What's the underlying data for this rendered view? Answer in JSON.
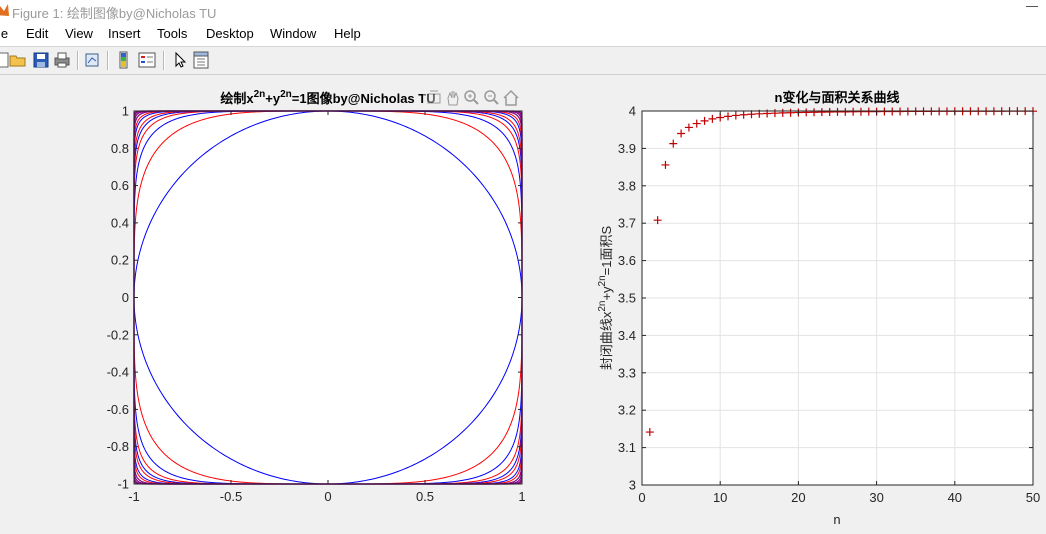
{
  "window": {
    "title": "Figure 1: 绘制图像by@Nicholas TU",
    "partial_menu_label": "le"
  },
  "menu": [
    "Edit",
    "View",
    "Insert",
    "Tools",
    "Desktop",
    "Window",
    "Help"
  ],
  "toolbar_icons": [
    "open-folder-icon",
    "save-icon",
    "print-icon",
    "link-plot-icon",
    "colorbar-icon",
    "legend-icon",
    "pointer-icon",
    "property-editor-icon"
  ],
  "axes_toolbar_icons": [
    "brush-icon",
    "pan-icon",
    "zoom-in-icon",
    "zoom-out-icon",
    "home-icon"
  ],
  "colors": {
    "blue": "#0000ff",
    "red": "#ff0000",
    "purple": "#800080",
    "marker": "#c00000"
  },
  "chart_data": [
    {
      "type": "line",
      "title_parts": {
        "prefix": "绘制x",
        "exp1": "2n",
        "mid": "+y",
        "exp2": "2n",
        "suffix": "=1图像by@Nicholas TU"
      },
      "xlabel": "",
      "ylabel": "",
      "xlim": [
        -1,
        1
      ],
      "ylim": [
        -1,
        1
      ],
      "xticks": [
        -1,
        -0.5,
        0,
        0.5,
        1
      ],
      "xtick_labels": [
        "-1",
        "-0.5",
        "0",
        "0.5",
        "1"
      ],
      "yticks": [
        -1,
        -0.8,
        -0.6,
        -0.4,
        -0.2,
        0,
        0.2,
        0.4,
        0.6,
        0.8,
        1
      ],
      "ytick_labels": [
        "-1",
        "-0.8",
        "-0.6",
        "-0.4",
        "-0.2",
        "0",
        "0.2",
        "0.4",
        "0.6",
        "0.8",
        "1"
      ],
      "grid": false,
      "curves": "superellipse x^(2n)+y^(2n)=1 for n=1..50",
      "n_values": [
        1,
        2,
        3,
        4,
        5,
        6,
        8,
        10,
        14,
        20,
        30,
        50
      ]
    },
    {
      "type": "scatter",
      "title": "n变化与面积关系曲线",
      "xlabel": "n",
      "ylabel_parts": {
        "prefix": "封闭曲线x",
        "exp1": "2n",
        "mid": "+y",
        "exp2": "2n",
        "suffix": "=1面积S"
      },
      "xlim": [
        0,
        50
      ],
      "ylim": [
        3,
        4
      ],
      "xticks": [
        0,
        10,
        20,
        30,
        40,
        50
      ],
      "xtick_labels": [
        "0",
        "10",
        "20",
        "30",
        "40",
        "50"
      ],
      "yticks": [
        3,
        3.1,
        3.2,
        3.3,
        3.4,
        3.5,
        3.6,
        3.7,
        3.8,
        3.9,
        4
      ],
      "ytick_labels": [
        "3",
        "3.1",
        "3.2",
        "3.3",
        "3.4",
        "3.5",
        "3.6",
        "3.7",
        "3.8",
        "3.9",
        "4"
      ],
      "grid": true,
      "marker": "+",
      "x": [
        1,
        2,
        3,
        4,
        5,
        6,
        7,
        8,
        9,
        10,
        11,
        12,
        13,
        14,
        15,
        16,
        17,
        18,
        19,
        20,
        21,
        22,
        23,
        24,
        25,
        26,
        27,
        28,
        29,
        30,
        31,
        32,
        33,
        34,
        35,
        36,
        37,
        38,
        39,
        40,
        41,
        42,
        43,
        44,
        45,
        46,
        47,
        48,
        49,
        50
      ],
      "y": [
        3.1416,
        3.7081,
        3.8558,
        3.9127,
        3.9399,
        3.956,
        3.9664,
        3.9736,
        3.9789,
        3.9827,
        3.9857,
        3.9881,
        3.9899,
        3.9913,
        3.9925,
        3.9934,
        3.9942,
        3.9949,
        3.9954,
        3.9959,
        3.9963,
        3.9967,
        3.997,
        3.9973,
        3.9975,
        3.9977,
        3.9979,
        3.9981,
        3.9982,
        3.9984,
        3.9985,
        3.9986,
        3.9987,
        3.9988,
        3.9989,
        3.9989,
        3.999,
        3.9991,
        3.9991,
        3.9992,
        3.9992,
        3.9993,
        3.9993,
        3.9994,
        3.9994,
        3.9994,
        3.9995,
        3.9995,
        3.9995,
        3.9995
      ]
    }
  ]
}
